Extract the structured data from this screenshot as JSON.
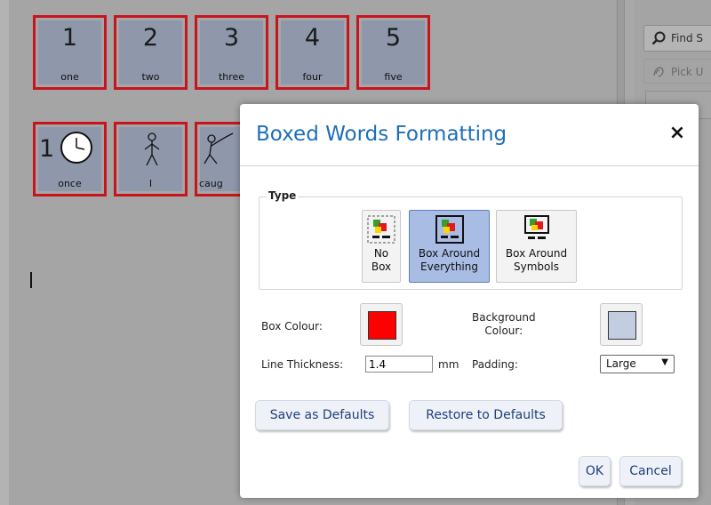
{
  "document": {
    "row1": [
      {
        "num": "1",
        "word": "one"
      },
      {
        "num": "2",
        "word": "two"
      },
      {
        "num": "3",
        "word": "three"
      },
      {
        "num": "4",
        "word": "four"
      },
      {
        "num": "5",
        "word": "five"
      }
    ],
    "row2": [
      {
        "num": "1",
        "word": "once"
      },
      {
        "num": "",
        "word": "I"
      },
      {
        "num": "",
        "word": "caug"
      }
    ]
  },
  "right_panel": {
    "find_label": "Find S",
    "pick_label": "Pick U"
  },
  "dialog": {
    "title": "Boxed Words Formatting",
    "close_glyph": "×",
    "type_legend": "Type",
    "type_options": [
      {
        "label": "No\nBox",
        "selected": false
      },
      {
        "label": "Box Around\nEverything",
        "selected": true
      },
      {
        "label": "Box Around\nSymbols",
        "selected": false
      }
    ],
    "box_colour_label": "Box Colour:",
    "box_colour": "#ff0000",
    "background_colour_label": "Background\nColour:",
    "background_colour": "#c3cde1",
    "line_thickness_label": "Line Thickness:",
    "line_thickness_value": "1.4",
    "line_thickness_unit": "mm",
    "padding_label": "Padding:",
    "padding_value": "Large",
    "save_defaults": "Save as Defaults",
    "restore_defaults": "Restore to Defaults",
    "ok": "OK",
    "cancel": "Cancel"
  }
}
